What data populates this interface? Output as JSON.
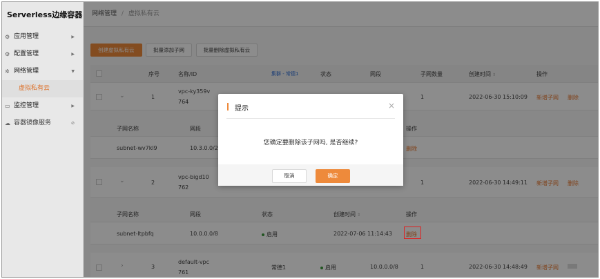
{
  "sidebar": {
    "brand": "Serverless边缘容器",
    "items": [
      {
        "label": "应用管理",
        "icon": "gear-icon"
      },
      {
        "label": "配置管理",
        "icon": "settings-icon"
      },
      {
        "label": "网络管理",
        "icon": "network-icon"
      },
      {
        "label": "虚拟私有云",
        "icon": ""
      },
      {
        "label": "监控管理",
        "icon": "monitor-icon"
      },
      {
        "label": "容器镜像服务",
        "icon": "cloud-icon"
      }
    ]
  },
  "breadcrumb": {
    "parent": "网络管理",
    "sep": "/",
    "current": "虚拟私有云"
  },
  "toolbar": {
    "create": "创建虚拟私有云",
    "batch_add": "批量添加子网",
    "batch_delete": "批量删除虚拟私有云"
  },
  "table": {
    "headers": {
      "seq": "序号",
      "name": "名称/ID",
      "zone": "集群 - 常德1",
      "status": "状态",
      "cidr": "网段",
      "subnets": "子网数量",
      "created": "创建时间",
      "ops": "操作"
    },
    "sub_headers": {
      "name": "子网名称",
      "cidr": "网段",
      "status": "状态",
      "created": "创建时间",
      "ops": "操作"
    },
    "vpcs": [
      {
        "seq": "1",
        "name": "vpc-ky359v",
        "id": "764",
        "subnets": "1",
        "created": "2022-06-30 15:10:09",
        "add": "新增子网",
        "del": "删除"
      },
      {
        "seq": "2",
        "name": "vpc-bigd10",
        "id": "762",
        "subnets": "1",
        "created": "2022-06-30 14:49:11",
        "add": "新增子网",
        "del": "删除"
      },
      {
        "seq": "3",
        "name": "default-vpc",
        "id": "761",
        "zone": "常德1",
        "status": "启用",
        "cidr": "10.0.0.0/8",
        "subnets": "1",
        "created": "2022-06-30 14:48:49",
        "add": "新增子网"
      }
    ],
    "subnets": [
      {
        "name": "subnet-wv7kl9",
        "cidr": "10.3.0.0/24",
        "del": "删除"
      },
      {
        "name": "subnet-ltpbfq",
        "cidr": "10.0.0.0/8",
        "status": "启用",
        "created": "2022-07-06 11:14:43",
        "del": "删除"
      }
    ]
  },
  "dialog": {
    "title": "提示",
    "message": "您确定要删除该子网吗, 是否继续?",
    "cancel": "取消",
    "confirm": "确定"
  }
}
